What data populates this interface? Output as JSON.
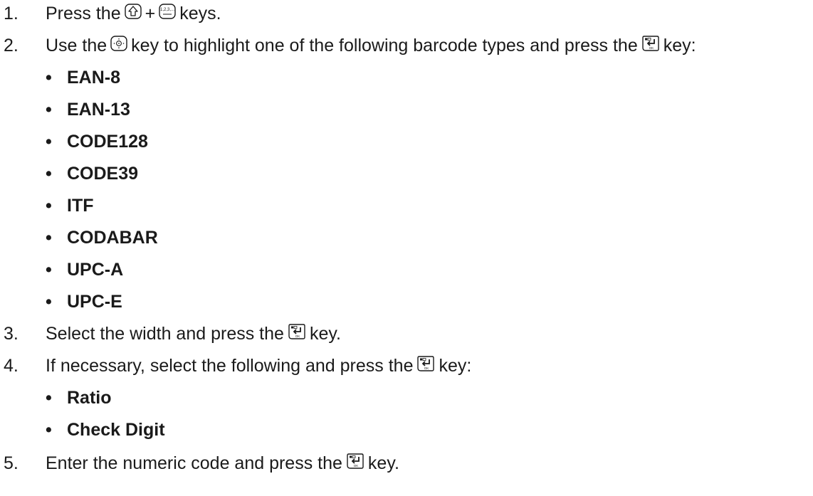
{
  "steps": [
    {
      "number": "1.",
      "text_a": "Press the",
      "plus": "+",
      "text_b": "keys.",
      "icons": [
        "shift-key-icon",
        "numeric-mode-key-icon"
      ],
      "key_label": "1,2,3,..."
    },
    {
      "number": "2.",
      "text_a": "Use the",
      "text_b": "key to highlight one of the following barcode types and press the",
      "text_c": "key:",
      "icons": [
        "navigation-pad-key-icon",
        "enter-ok-key-icon"
      ],
      "bullets": [
        "EAN-8",
        "EAN-13",
        "CODE128",
        "CODE39",
        "ITF",
        "CODABAR",
        "UPC-A",
        "UPC-E"
      ]
    },
    {
      "number": "3.",
      "text_a": "Select the width and press the",
      "text_b": "key.",
      "icons": [
        "enter-ok-key-icon"
      ]
    },
    {
      "number": "4.",
      "text_a": "If necessary, select the following and press the",
      "text_b": "key:",
      "icons": [
        "enter-ok-key-icon"
      ],
      "bullets": [
        "Ratio",
        "Check Digit"
      ]
    },
    {
      "number": "5.",
      "text_a": "Enter the numeric code and press the",
      "text_b": "key.",
      "icons": [
        "enter-ok-key-icon"
      ]
    }
  ],
  "bullet_char": "•",
  "ok_label": "OK"
}
